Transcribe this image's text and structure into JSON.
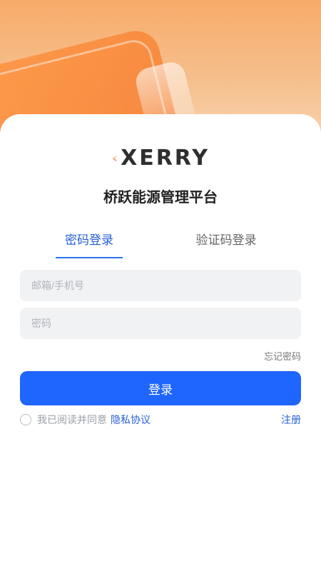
{
  "brand": {
    "logo_text": "XERRY",
    "app_title": "桥跃能源管理平台",
    "colors": {
      "primary": "#1f65ff",
      "link": "#2860d8",
      "header_orange": "#f7ab6b",
      "logo_ray_primary": "#f28c28"
    }
  },
  "tabs": [
    {
      "label": "密码登录",
      "active": true
    },
    {
      "label": "验证码登录",
      "active": false
    }
  ],
  "form": {
    "email_placeholder": "邮箱/手机号",
    "email_value": "",
    "password_placeholder": "密码",
    "password_value": "",
    "forgot_label": "忘记密码",
    "login_label": "登录"
  },
  "agreement": {
    "checked": false,
    "text": "我已阅读并同意",
    "link_label": "隐私协议"
  },
  "register_label": "注册",
  "icons": {
    "logo_mark": "sun-rays-icon",
    "checkbox": "radio-circle-icon"
  }
}
